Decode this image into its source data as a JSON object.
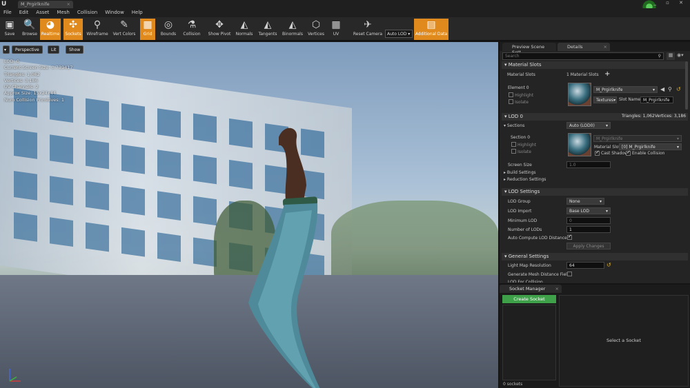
{
  "app": {
    "tab_title": "M_Prgirlknife",
    "logo": "U"
  },
  "menu": [
    "File",
    "Edit",
    "Asset",
    "Mesh",
    "Collision",
    "Window",
    "Help"
  ],
  "toolbar": [
    {
      "label": "Save",
      "icon": "save-icon",
      "glyph": "▣",
      "active": false
    },
    {
      "label": "Browse",
      "icon": "browse-icon",
      "glyph": "🔍",
      "active": false
    },
    {
      "label": "Realtime",
      "icon": "realtime-icon",
      "glyph": "◕",
      "active": true
    },
    {
      "label": "Sockets",
      "icon": "sockets-icon",
      "glyph": "✣",
      "active": true
    },
    {
      "label": "Wireframe",
      "icon": "wireframe-icon",
      "glyph": "⚲",
      "active": false
    },
    {
      "label": "Vert Colors",
      "icon": "vert-colors-icon",
      "glyph": "✎",
      "active": false
    },
    {
      "label": "Grid",
      "icon": "grid-icon",
      "glyph": "▦",
      "active": true
    },
    {
      "label": "Bounds",
      "icon": "bounds-icon",
      "glyph": "◎",
      "active": false
    },
    {
      "label": "Collision",
      "icon": "collision-icon",
      "glyph": "⚗",
      "active": false
    },
    {
      "label": "Show Pivot",
      "icon": "pivot-icon",
      "glyph": "✥",
      "active": false
    },
    {
      "label": "Normals",
      "icon": "normals-icon",
      "glyph": "◭",
      "active": false
    },
    {
      "label": "Tangents",
      "icon": "tangents-icon",
      "glyph": "◭",
      "active": false
    },
    {
      "label": "Binormals",
      "icon": "binormals-icon",
      "glyph": "◭",
      "active": false
    },
    {
      "label": "Vertices",
      "icon": "vertices-icon",
      "glyph": "⬡",
      "active": false
    },
    {
      "label": "UV",
      "icon": "uv-icon",
      "glyph": "▦",
      "active": false
    },
    {
      "label": "Reset Camera",
      "icon": "reset-camera-icon",
      "glyph": "✈",
      "active": false
    },
    {
      "label": "Additional Data",
      "icon": "additional-data-icon",
      "glyph": "▤",
      "active": true
    }
  ],
  "auto_lod": "Auto LOD",
  "viewport": {
    "perspective": "Perspective",
    "lit": "Lit",
    "show": "Show",
    "stats": [
      "LOD: 0",
      "Current Screen Size: 0.739417",
      "Triangles: 1,062",
      "Vertices: 3,186",
      "UV Channels: 2",
      "Approx Size: 15x24x44",
      "Num Collision Primitives: 1"
    ]
  },
  "panel_tabs": {
    "preview": "Preview Scene Sett",
    "details": "Details"
  },
  "search_placeholder": "Search",
  "material_slots": {
    "header": "Material Slots",
    "label": "Material Slots",
    "count": "1 Material Slots",
    "element": "Element 0",
    "highlight": "Highlight",
    "isolate": "Isolate",
    "material": "M_Prgirlknife",
    "textures": "Textures",
    "slot_name_label": "Slot Name",
    "slot_name": "M_Prgirlknife"
  },
  "lod0": {
    "header": "LOD 0",
    "triangles": "Triangles: 1,062",
    "vertices": "Vertices: 3,186",
    "sections_label": "Sections",
    "sections_value": "Auto (LOD0)",
    "section0": "Section 0",
    "highlight": "Highlight",
    "isolate": "Isolate",
    "material": "M_Prgirlknife",
    "material_slot_label": "Material Slot",
    "material_slot": "[0] M_Prgirlknife",
    "cast_shadow": "Cast Shadow",
    "enable_collision": "Enable Collision",
    "screen_size_label": "Screen Size",
    "screen_size": "1.0",
    "build_settings": "Build Settings",
    "reduction_settings": "Reduction Settings"
  },
  "lod_settings": {
    "header": "LOD Settings",
    "group_label": "LOD Group",
    "group": "None",
    "import_label": "LOD Import",
    "import": "Base LOD",
    "min_label": "Minimum LOD",
    "min": "0",
    "num_label": "Number of LODs",
    "num": "1",
    "auto_label": "Auto Compute LOD Distances",
    "apply": "Apply Changes"
  },
  "general": {
    "header": "General Settings",
    "lightmap_label": "Light Map Resolution",
    "lightmap": "64",
    "distance_label": "Generate Mesh Distance Field",
    "lod_collision_label": "LOD For Collision"
  },
  "socket_manager": {
    "title": "Socket Manager",
    "create": "Create Socket",
    "select": "Select a Socket",
    "count": "0 sockets"
  }
}
